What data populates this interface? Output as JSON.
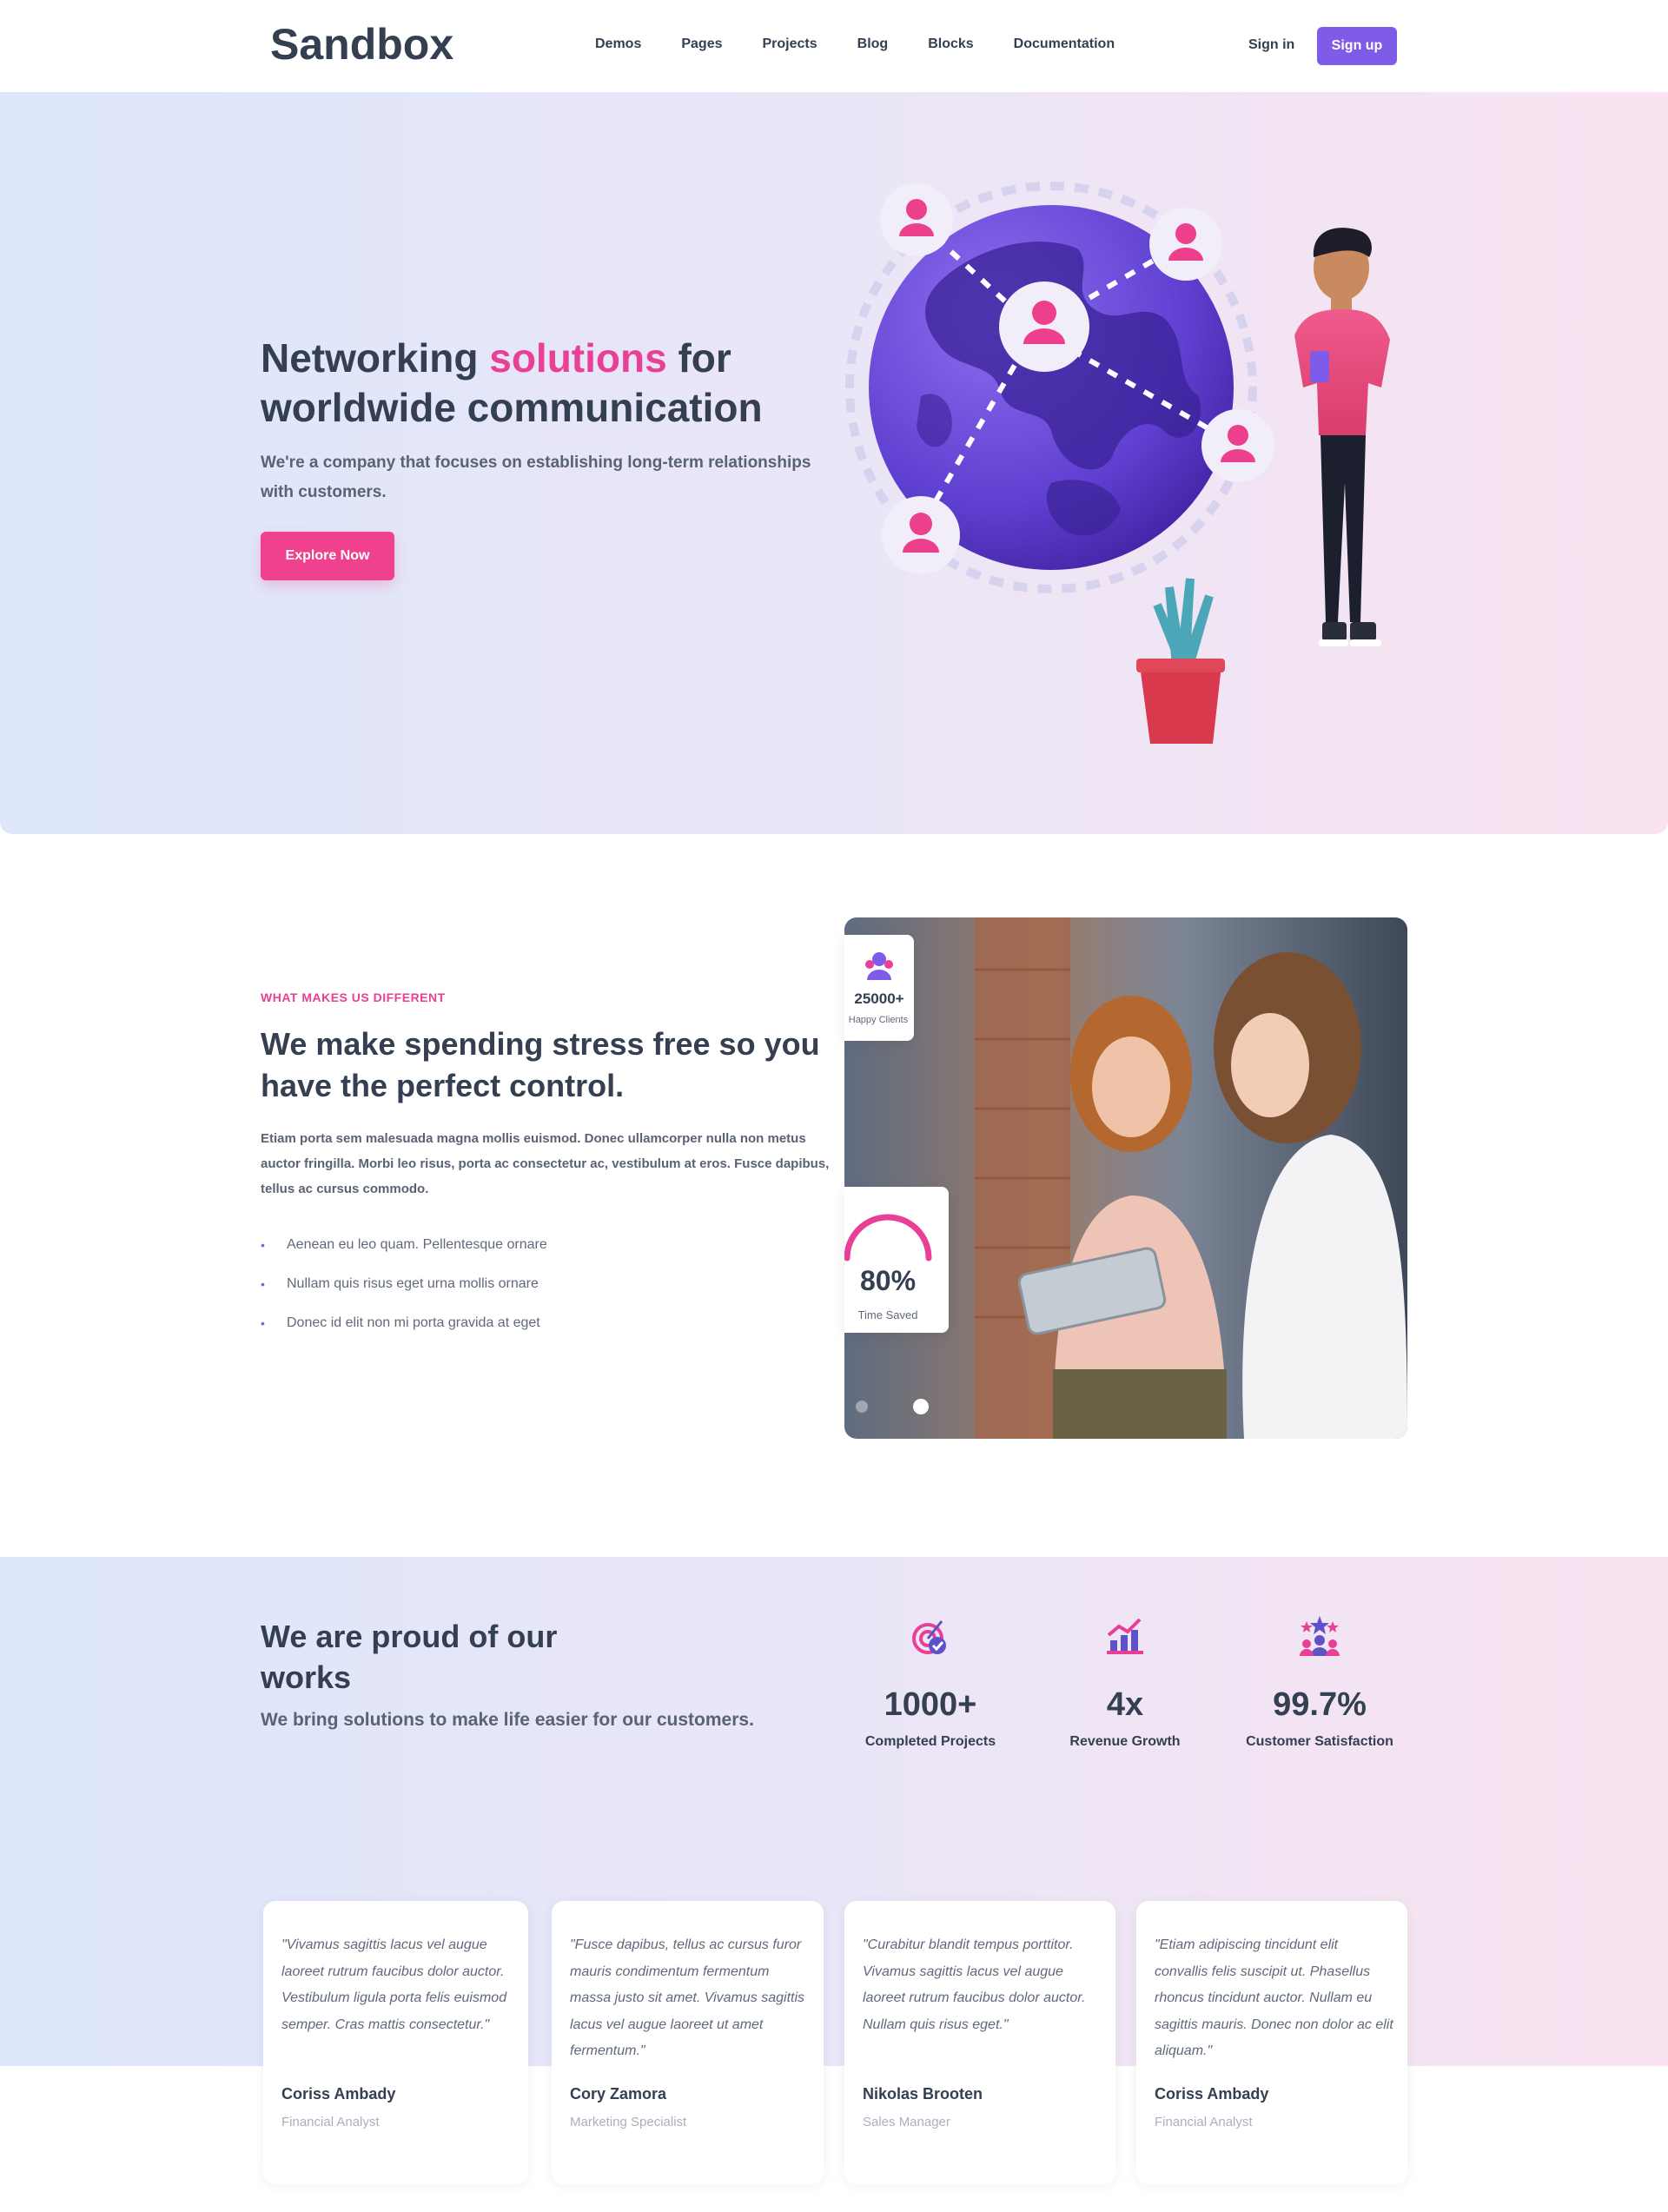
{
  "header": {
    "logo": "Sandbox",
    "nav": [
      "Demos",
      "Pages",
      "Projects",
      "Blog",
      "Blocks",
      "Documentation"
    ],
    "signin": "Sign in",
    "signup": "Sign up"
  },
  "hero": {
    "title_pre": "Networking ",
    "title_highlight": "solutions",
    "title_post": " for worldwide communication",
    "subtitle": "We're a company that focuses on establishing long-term relationships with customers.",
    "button": "Explore Now",
    "colors": {
      "accent": "#e93f96",
      "globe": "#6d4ed8",
      "bg_left": "#dde6fb",
      "bg_right": "#f9e3f0"
    }
  },
  "about": {
    "overline": "WHAT MAKES US DIFFERENT",
    "title": "We make spending stress free so you have the perfect control.",
    "text": "Etiam porta sem malesuada magna mollis euismod. Donec ullamcorper nulla non metus auctor fringilla. Morbi leo risus, porta ac consectetur ac, vestibulum at eros. Fusce dapibus, tellus ac cursus commodo.",
    "bullets": [
      "Aenean eu leo quam. Pellentesque ornare",
      "Nullam quis risus eget urna mollis ornare",
      "Donec id elit non mi porta gravida at eget"
    ],
    "stat1": {
      "value": "25000+",
      "label": "Happy Clients",
      "icon": "users-icon"
    },
    "stat2": {
      "value": "80%",
      "label": "Time Saved",
      "progress": 0.8
    }
  },
  "proud": {
    "title": "We are proud of our works",
    "subtitle": "We bring solutions to make life easier for our customers.",
    "stats": [
      {
        "value": "1000+",
        "label": "Completed Projects",
        "icon": "target-icon"
      },
      {
        "value": "4x",
        "label": "Revenue Growth",
        "icon": "growth-chart-icon"
      },
      {
        "value": "99.7%",
        "label": "Customer Satisfaction",
        "icon": "team-stars-icon"
      }
    ]
  },
  "testimonials": [
    {
      "quote": "\"Vivamus sagittis lacus vel augue laoreet rutrum faucibus dolor auctor. Vestibulum ligula porta felis euismod semper. Cras mattis consectetur.\"",
      "name": "Coriss Ambady",
      "role": "Financial Analyst"
    },
    {
      "quote": "\"Fusce dapibus, tellus ac cursus furor mauris condimentum fermentum massa justo sit amet. Vivamus sagittis lacus vel augue laoreet ut amet fermentum.\"",
      "name": "Cory Zamora",
      "role": "Marketing Specialist"
    },
    {
      "quote": "\"Curabitur blandit tempus porttitor. Vivamus sagittis lacus vel augue laoreet rutrum faucibus dolor auctor. Nullam quis risus eget.\"",
      "name": "Nikolas Brooten",
      "role": "Sales Manager"
    },
    {
      "quote": "\"Etiam adipiscing tincidunt elit convallis felis suscipit ut. Phasellus rhoncus tincidunt auctor. Nullam eu sagittis mauris. Donec non dolor ac elit aliquam.\"",
      "name": "Coriss Ambady",
      "role": "Financial Analyst"
    }
  ]
}
